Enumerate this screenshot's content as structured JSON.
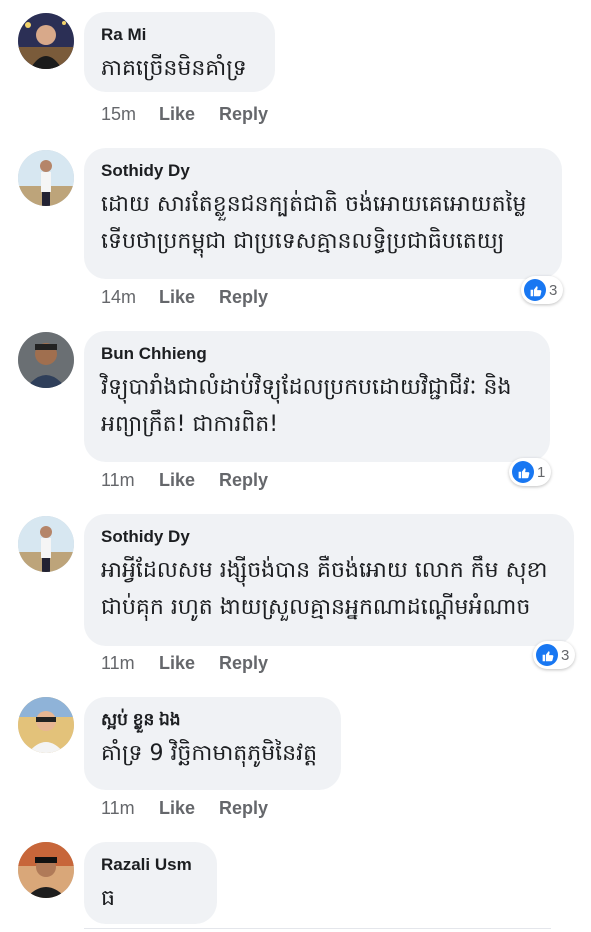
{
  "comments": [
    {
      "author": "Ra Mi",
      "text": "ភាគច្រើនមិនគាំទ្រ",
      "time": "15m",
      "like": "Like",
      "reply": "Reply",
      "reactions": ""
    },
    {
      "author": "Sothidy Dy",
      "text": "ដោយ សារតែខ្លួនជនក្បត់ជាតិ ចង់អោយគេអោយតម្លៃ\nទើបថាប្រកម្ពុជា ជាប្រទេសគ្មានលទ្ធិប្រជាធិបតេយ្យ",
      "time": "14m",
      "like": "Like",
      "reply": "Reply",
      "reactions": "3"
    },
    {
      "author": "Bun Chhieng",
      "text": "វិទ្យុបារាំងជាលំដាប់វិទ្យុដែលប្រកបដោយវិជ្ជាជីវៈ និង\nអព្យាក្រឹត! ជាការពិត!",
      "time": "11m",
      "like": "Like",
      "reply": "Reply",
      "reactions": "1"
    },
    {
      "author": "Sothidy Dy",
      "text": "អាអ្វីដែលសម រង្ស៊ីចង់បាន គឺចង់អោយ លោក កឹម សុខា\nជាប់គុក រហូត ងាយស្រួលគ្មានអ្នកណាដណ្ដើមអំណាច",
      "time": "11m",
      "like": "Like",
      "reply": "Reply",
      "reactions": "3"
    },
    {
      "author": "ស្អប់ ខ្លួន ឯង",
      "text": "គាំទ្រ 9 វិច្ឆិកាមាតុភូមិនៃវត្ត",
      "time": "11m",
      "like": "Like",
      "reply": "Reply",
      "reactions": ""
    },
    {
      "author": "Razali Usm",
      "text": "ធ",
      "time": "",
      "like": "",
      "reply": "",
      "reactions": ""
    }
  ],
  "colors": {
    "bubble": "#f0f2f5",
    "like_blue": "#1877f2",
    "meta_gray": "#65676b"
  },
  "icons": {
    "reaction": "like-reaction-icon"
  }
}
